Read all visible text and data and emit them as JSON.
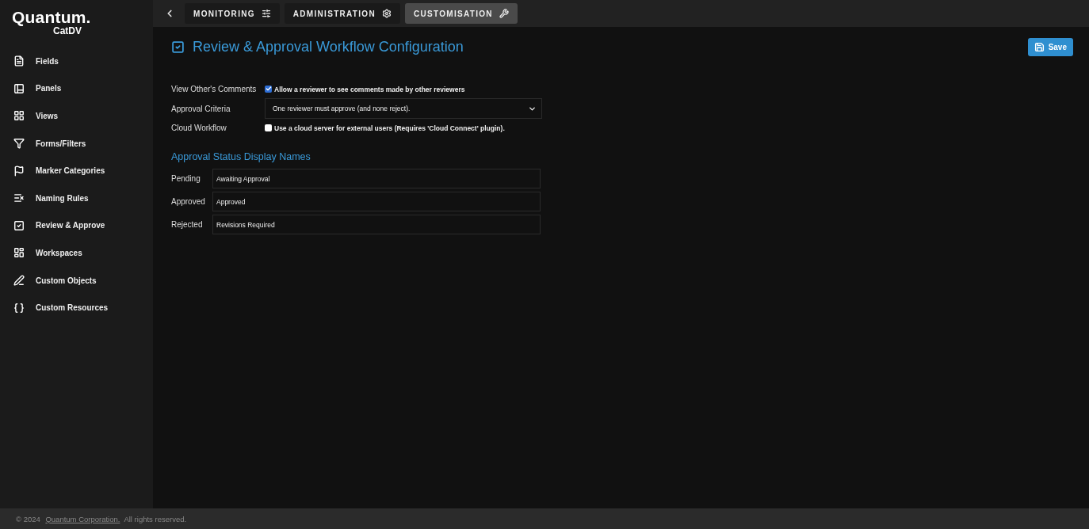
{
  "logo": {
    "brand": "Quantum.",
    "product": "CatDV"
  },
  "sidebar": {
    "items": [
      {
        "label": "Fields"
      },
      {
        "label": "Panels"
      },
      {
        "label": "Views"
      },
      {
        "label": "Forms/Filters"
      },
      {
        "label": "Marker Categories"
      },
      {
        "label": "Naming Rules"
      },
      {
        "label": "Review & Approve"
      },
      {
        "label": "Workspaces"
      },
      {
        "label": "Custom Objects"
      },
      {
        "label": "Custom Resources"
      }
    ]
  },
  "tabs": [
    {
      "label": "MONITORING",
      "selected": false
    },
    {
      "label": "ADMINISTRATION",
      "selected": false
    },
    {
      "label": "CUSTOMISATION",
      "selected": true
    }
  ],
  "page": {
    "title": "Review & Approval Workflow Configuration",
    "save_button": "Save"
  },
  "settings": [
    {
      "kind": "checkbox",
      "label": "View Other's Comments",
      "text": "Allow a reviewer to see comments made by other reviewers",
      "checked": true
    },
    {
      "kind": "select",
      "label": "Approval Criteria",
      "value": "One reviewer must approve (and none reject)."
    },
    {
      "kind": "checkbox",
      "label": "Cloud Workflow",
      "text": "Use a cloud server for external users (Requires 'Cloud Connect' plugin).",
      "checked": false
    }
  ],
  "status_names": {
    "heading": "Approval Status Display Names",
    "rows": [
      {
        "label": "Pending",
        "value": "Awaiting Approval"
      },
      {
        "label": "Approved",
        "value": "Approved"
      },
      {
        "label": "Rejected",
        "value": "Revisions Required"
      }
    ]
  },
  "footer": {
    "copyright": "© 2024",
    "link": "Quantum Corporation.",
    "rights": "All rights reserved."
  }
}
